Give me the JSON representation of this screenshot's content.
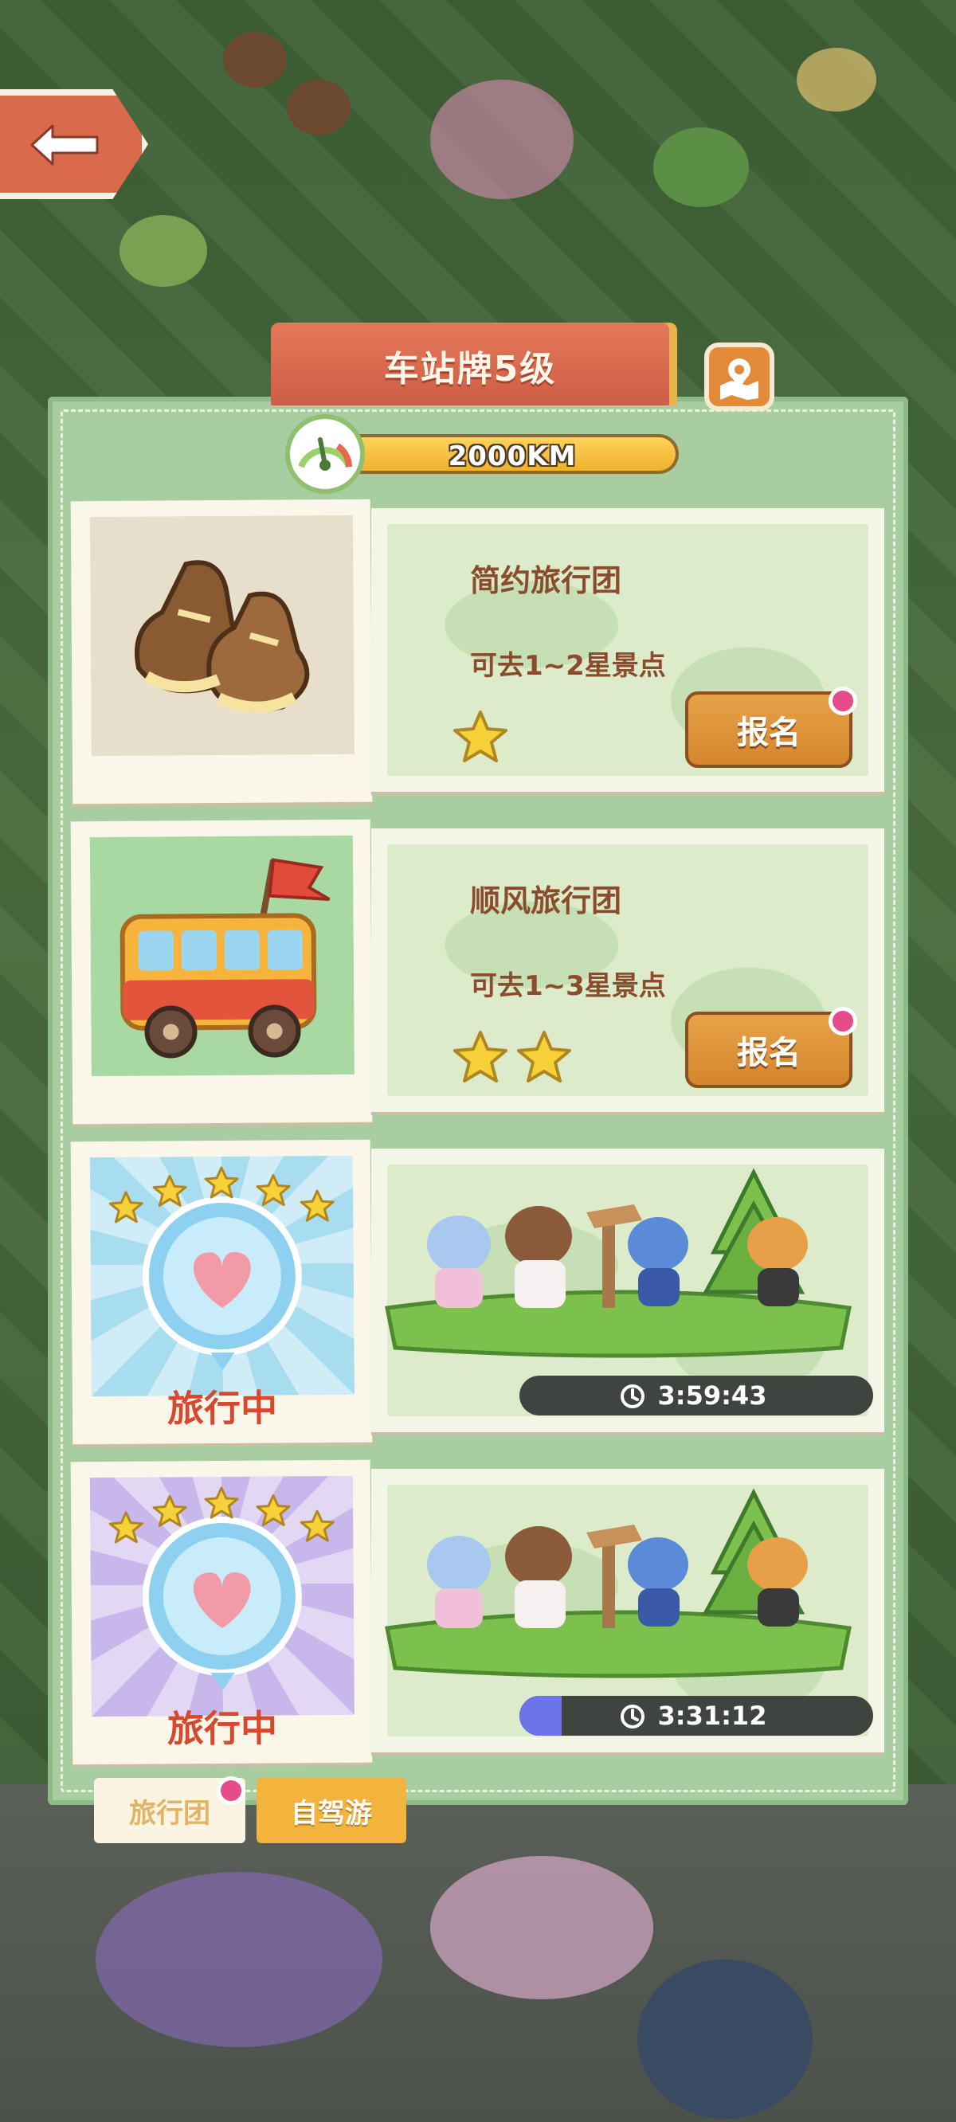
{
  "panel": {
    "title": "车站牌5级",
    "distance": "2000KM"
  },
  "tours": [
    {
      "name": "简约旅行团",
      "desc": "可去1~2星景点",
      "stars": 1,
      "action": "报名",
      "icon": "boots-icon"
    },
    {
      "name": "顺风旅行团",
      "desc": "可去1~3星景点",
      "stars": 2,
      "action": "报名",
      "icon": "bus-icon"
    }
  ],
  "active_tours": [
    {
      "status": "旅行中",
      "timer": "3:59:43",
      "progress": 0,
      "badge_stars": 5,
      "badge_theme": "#a8dcef"
    },
    {
      "status": "旅行中",
      "timer": "3:31:12",
      "progress": 0.12,
      "badge_stars": 5,
      "badge_theme": "#c8b7ea"
    }
  ],
  "tabs": {
    "group": "旅行团",
    "self_drive": "自驾游"
  },
  "colors": {
    "accent_orange": "#d96a4c",
    "panel_green": "#a7cda1",
    "button_orange": "#d4862e",
    "status_red": "#d6492f",
    "badge_pink": "#e64b8a",
    "progress_blue": "#6b73e8"
  }
}
